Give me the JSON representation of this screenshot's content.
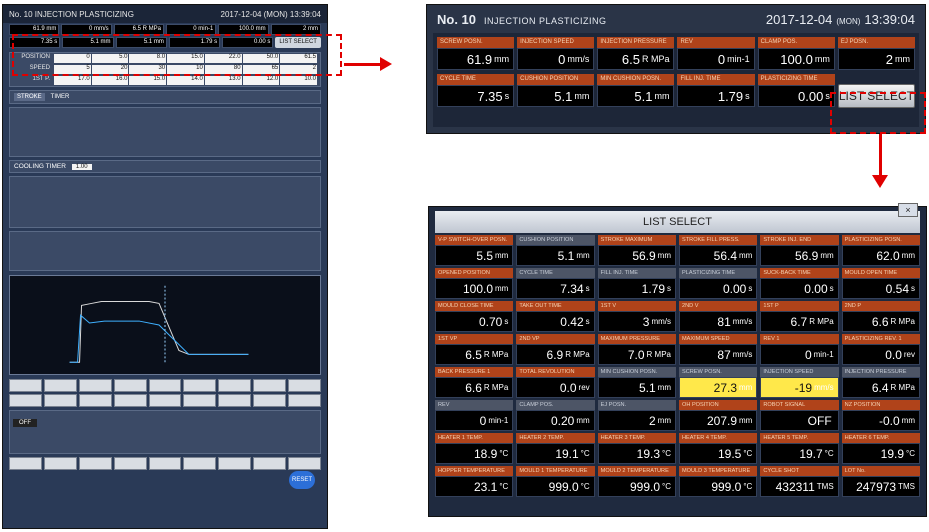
{
  "left": {
    "title": "No. 10  INJECTION PLASTICIZING",
    "datetime": "2017-12-04 (MON) 13:39:04",
    "mini_row1": [
      "61.9 mm",
      "0 mm/s",
      "6.5 R MPa",
      "0 min-1",
      "100.0 mm",
      "2 mm"
    ],
    "mini_row2": [
      "7.35 s",
      "5.1 mm",
      "5.1 mm",
      "1.79 s",
      "0.00 s"
    ],
    "mini_list_select": "LIST SELECT",
    "inj_rows": [
      {
        "label": "POSITION",
        "vals": [
          "0",
          "5.0",
          "8.0",
          "15.0",
          "22.0",
          "50.0",
          "61.5"
        ]
      },
      {
        "label": "SPEED",
        "vals": [
          "5",
          "20",
          "30",
          "10",
          "80",
          "65",
          "2"
        ]
      },
      {
        "label": "1ST P.",
        "vals": [
          "17.0",
          "16.0",
          "15.0",
          "14.0",
          "13.0",
          "12.0",
          "10.0"
        ]
      }
    ],
    "stroke_label": "STROKE",
    "timer_label": "TIMER",
    "cooling_label": "COOLING TIMER",
    "cooling_val": "1.00",
    "reset_label": "RESET",
    "off_label": "OFF"
  },
  "top": {
    "screen_no": "No. 10",
    "screen_name": "INJECTION PLASTICIZING",
    "date": "2017-12-04",
    "day": "(MON)",
    "time": "13:39:04",
    "row1": [
      {
        "label": "SCREW POSN.",
        "value": "61.9",
        "unit": "mm"
      },
      {
        "label": "INJECTION SPEED",
        "value": "0",
        "unit": "mm/s"
      },
      {
        "label": "INJECTION PRESSURE",
        "value": "6.5",
        "unit": "R MPa"
      },
      {
        "label": "REV",
        "value": "0",
        "unit": "min-1"
      },
      {
        "label": "CLAMP POS.",
        "value": "100.0",
        "unit": "mm"
      },
      {
        "label": "EJ POSN.",
        "value": "2",
        "unit": "mm"
      }
    ],
    "row2": [
      {
        "label": "CYCLE TIME",
        "value": "7.35",
        "unit": "s"
      },
      {
        "label": "CUSHION POSITION",
        "value": "5.1",
        "unit": "mm"
      },
      {
        "label": "MIN CUSHION POSN.",
        "value": "5.1",
        "unit": "mm"
      },
      {
        "label": "FILL INJ. TIME",
        "value": "1.79",
        "unit": "s"
      },
      {
        "label": "PLASTICIZING TIME",
        "value": "0.00",
        "unit": "s"
      }
    ],
    "list_select_label": "LIST SELECT"
  },
  "list": {
    "title": "LIST SELECT",
    "close": "×",
    "cells": [
      {
        "label": "V-P SWITCH-OVER POSN.",
        "value": "5.5",
        "unit": "mm",
        "tone": "o"
      },
      {
        "label": "CUSHION POSITION",
        "value": "5.1",
        "unit": "mm",
        "tone": "g"
      },
      {
        "label": "STROKE MAXIMUM",
        "value": "56.9",
        "unit": "mm",
        "tone": "o"
      },
      {
        "label": "STROKE FILL PRESS.",
        "value": "56.4",
        "unit": "mm",
        "tone": "o"
      },
      {
        "label": "STROKE INJ. END",
        "value": "56.9",
        "unit": "mm",
        "tone": "o"
      },
      {
        "label": "PLASTICIZING POSN.",
        "value": "62.0",
        "unit": "mm",
        "tone": "o"
      },
      {
        "label": "OPENED POSITION",
        "value": "100.0",
        "unit": "mm",
        "tone": "o"
      },
      {
        "label": "CYCLE TIME",
        "value": "7.34",
        "unit": "s",
        "tone": "g"
      },
      {
        "label": "FILL INJ. TIME",
        "value": "1.79",
        "unit": "s",
        "tone": "g"
      },
      {
        "label": "PLASTICIZING TIME",
        "value": "0.00",
        "unit": "s",
        "tone": "g"
      },
      {
        "label": "SUCK-BACK TIME",
        "value": "0.00",
        "unit": "s",
        "tone": "o"
      },
      {
        "label": "MOULD OPEN TIME",
        "value": "0.54",
        "unit": "s",
        "tone": "o"
      },
      {
        "label": "MOULD CLOSE TIME",
        "value": "0.70",
        "unit": "s",
        "tone": "o"
      },
      {
        "label": "TAKE OUT TIME",
        "value": "0.42",
        "unit": "s",
        "tone": "o"
      },
      {
        "label": "1ST V",
        "value": "3",
        "unit": "mm/s",
        "tone": "o"
      },
      {
        "label": "2ND V",
        "value": "81",
        "unit": "mm/s",
        "tone": "o"
      },
      {
        "label": "1ST P",
        "value": "6.7",
        "unit": "R MPa",
        "tone": "o"
      },
      {
        "label": "2ND P",
        "value": "6.6",
        "unit": "R MPa",
        "tone": "o"
      },
      {
        "label": "1ST VP",
        "value": "6.5",
        "unit": "R MPa",
        "tone": "o"
      },
      {
        "label": "2ND VP",
        "value": "6.9",
        "unit": "R MPa",
        "tone": "o"
      },
      {
        "label": "MAXIMUM PRESSURE",
        "value": "7.0",
        "unit": "R MPa",
        "tone": "o"
      },
      {
        "label": "MAXIMUM SPEED",
        "value": "87",
        "unit": "mm/s",
        "tone": "o"
      },
      {
        "label": "REV 1",
        "value": "0",
        "unit": "min-1",
        "tone": "o"
      },
      {
        "label": "PLASTICIZING REV. 1",
        "value": "0.0",
        "unit": "rev",
        "tone": "o"
      },
      {
        "label": "BACK PRESSURE 1",
        "value": "6.6",
        "unit": "R MPa",
        "tone": "o"
      },
      {
        "label": "TOTAL REVOLUTION",
        "value": "0.0",
        "unit": "rev",
        "tone": "o"
      },
      {
        "label": "MIN CUSHION POSN.",
        "value": "5.1",
        "unit": "mm",
        "tone": "g"
      },
      {
        "label": "SCREW POSN.",
        "value": "27.3",
        "unit": "mm",
        "tone": "g",
        "hl": true
      },
      {
        "label": "INJECTION SPEED",
        "value": "-19",
        "unit": "mm/s",
        "tone": "g",
        "hl": true
      },
      {
        "label": "INJECTION PRESSURE",
        "value": "6.4",
        "unit": "R MPa",
        "tone": "g"
      },
      {
        "label": "REV",
        "value": "0",
        "unit": "min-1",
        "tone": "g"
      },
      {
        "label": "CLAMP POS.",
        "value": "0.20",
        "unit": "mm",
        "tone": "g"
      },
      {
        "label": "EJ POSN.",
        "value": "2",
        "unit": "mm",
        "tone": "g"
      },
      {
        "label": "OH POSITION",
        "value": "207.9",
        "unit": "mm",
        "tone": "o"
      },
      {
        "label": "ROBOT SIGNAL",
        "value": "OFF",
        "unit": "",
        "tone": "o"
      },
      {
        "label": "NZ POSITION",
        "value": "-0.0",
        "unit": "mm",
        "tone": "o"
      },
      {
        "label": "HEATER 1 TEMP.",
        "value": "18.9",
        "unit": "°C",
        "tone": "o"
      },
      {
        "label": "HEATER 2 TEMP.",
        "value": "19.1",
        "unit": "°C",
        "tone": "o"
      },
      {
        "label": "HEATER 3 TEMP.",
        "value": "19.3",
        "unit": "°C",
        "tone": "o"
      },
      {
        "label": "HEATER 4 TEMP.",
        "value": "19.5",
        "unit": "°C",
        "tone": "o"
      },
      {
        "label": "HEATER 5 TEMP.",
        "value": "19.7",
        "unit": "°C",
        "tone": "o"
      },
      {
        "label": "HEATER 6 TEMP.",
        "value": "19.9",
        "unit": "°C",
        "tone": "o"
      },
      {
        "label": "HOPPER TEMPERATURE",
        "value": "23.1",
        "unit": "°C",
        "tone": "o"
      },
      {
        "label": "MOULD 1 TEMPERATURE",
        "value": "999.0",
        "unit": "°C",
        "tone": "o"
      },
      {
        "label": "MOULD 2 TEMPERATURE",
        "value": "999.0",
        "unit": "°C",
        "tone": "o"
      },
      {
        "label": "MOULD 3 TEMPERATURE",
        "value": "999.0",
        "unit": "°C",
        "tone": "o"
      },
      {
        "label": "CYCLE SHOT",
        "value": "432311",
        "unit": "TMS",
        "tone": "o"
      },
      {
        "label": "LOT No.",
        "value": "247973",
        "unit": "TMS",
        "tone": "o"
      }
    ]
  },
  "colors": {
    "accent": "#b0431a",
    "panel": "#1f2a3f",
    "highlight": "#ffe84a",
    "callout": "#e00000"
  }
}
